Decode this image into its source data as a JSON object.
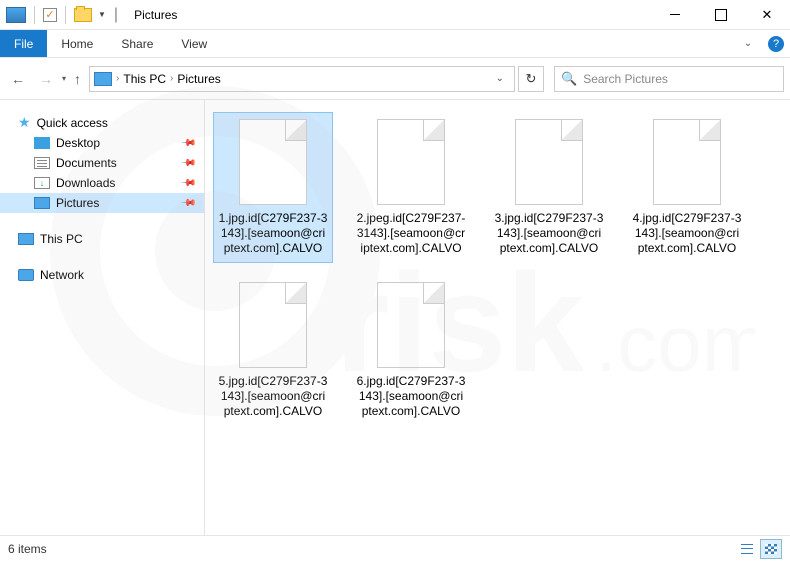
{
  "titlebar": {
    "title": "Pictures"
  },
  "ribbon": {
    "file": "File",
    "tabs": [
      "Home",
      "Share",
      "View"
    ]
  },
  "address": {
    "crumbs": [
      "This PC",
      "Pictures"
    ]
  },
  "search": {
    "placeholder": "Search Pictures"
  },
  "sidebar": {
    "quick_access": "Quick access",
    "items": [
      {
        "label": "Desktop",
        "icon": "desktop",
        "pinned": true
      },
      {
        "label": "Documents",
        "icon": "docs",
        "pinned": true
      },
      {
        "label": "Downloads",
        "icon": "down",
        "pinned": true
      },
      {
        "label": "Pictures",
        "icon": "pics",
        "pinned": true,
        "selected": true
      }
    ],
    "this_pc": "This PC",
    "network": "Network"
  },
  "files": [
    {
      "name": "1.jpg.id[C279F237-3143].[seamoon@criptext.com].CALVO",
      "selected": true
    },
    {
      "name": "2.jpeg.id[C279F237-3143].[seamoon@criptext.com].CALVO"
    },
    {
      "name": "3.jpg.id[C279F237-3143].[seamoon@criptext.com].CALVO"
    },
    {
      "name": "4.jpg.id[C279F237-3143].[seamoon@criptext.com].CALVO"
    },
    {
      "name": "5.jpg.id[C279F237-3143].[seamoon@criptext.com].CALVO"
    },
    {
      "name": "6.jpg.id[C279F237-3143].[seamoon@criptext.com].CALVO"
    }
  ],
  "statusbar": {
    "count_label": "6 items"
  }
}
